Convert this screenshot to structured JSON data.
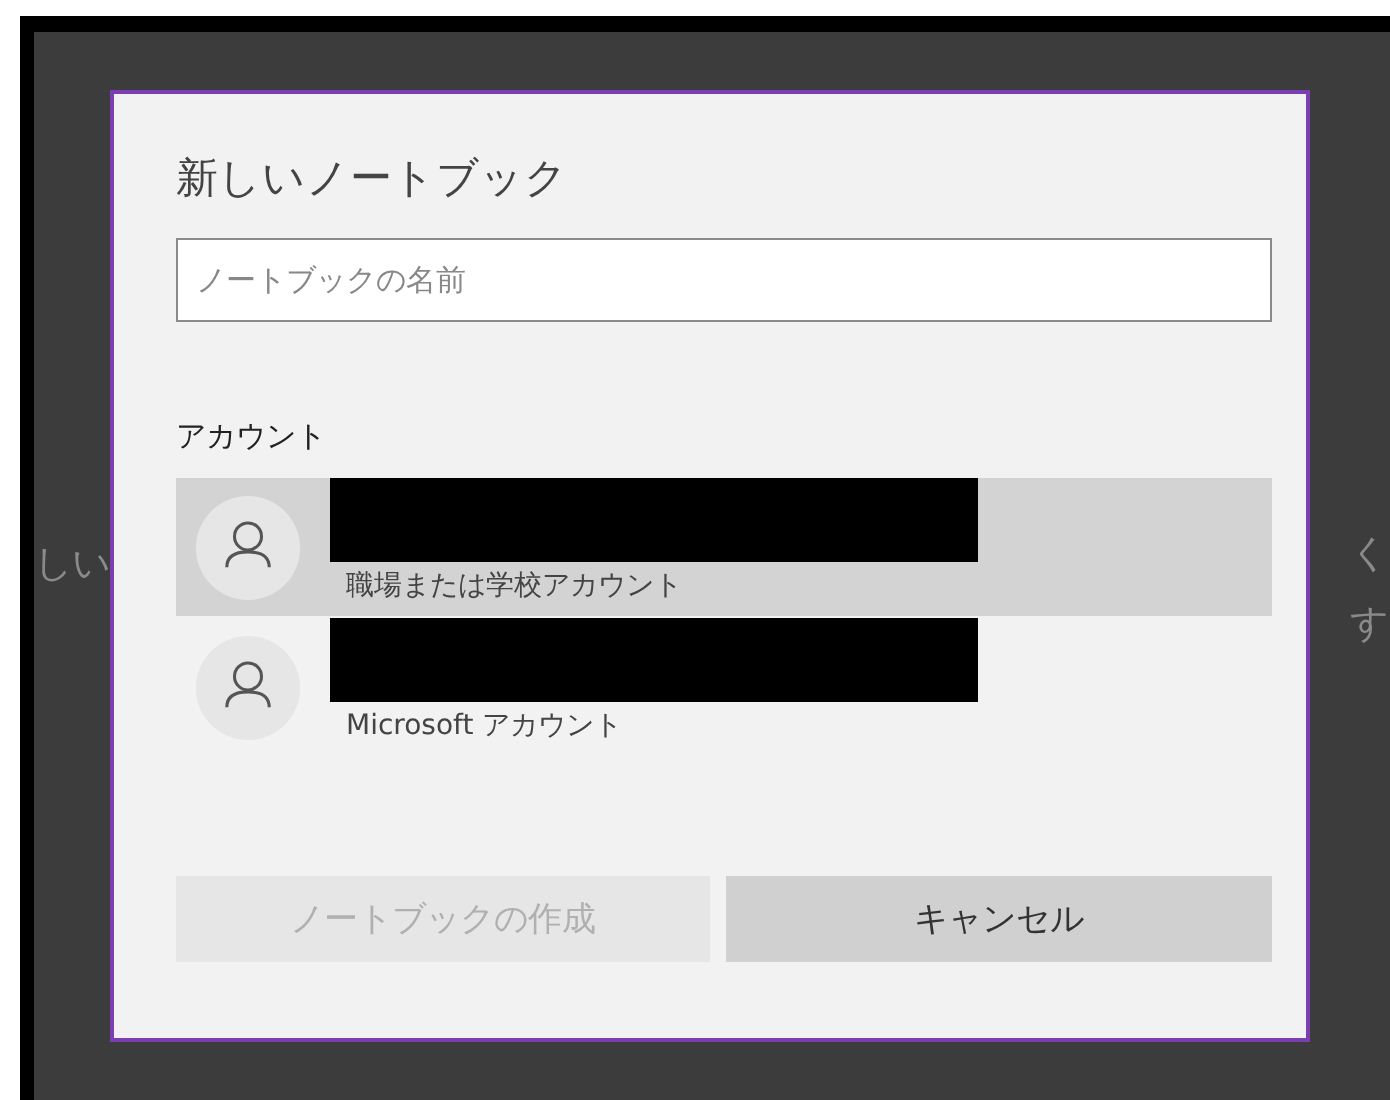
{
  "background_left_texts": [
    "しい"
  ],
  "background_right_texts": [
    "く",
    "す"
  ],
  "dialog": {
    "title": "新しいノートブック",
    "name_field": {
      "placeholder": "ノートブックの名前"
    },
    "accounts_heading": "アカウント",
    "accounts": [
      {
        "selected": true,
        "redacted": true,
        "type": "職場または学校アカウント"
      },
      {
        "selected": false,
        "redacted": true,
        "type": "Microsoft アカウント"
      }
    ],
    "buttons": [
      {
        "label": "ノートブックの作成",
        "disabled": true
      },
      {
        "label": "キャンセル",
        "disabled": false
      }
    ]
  }
}
